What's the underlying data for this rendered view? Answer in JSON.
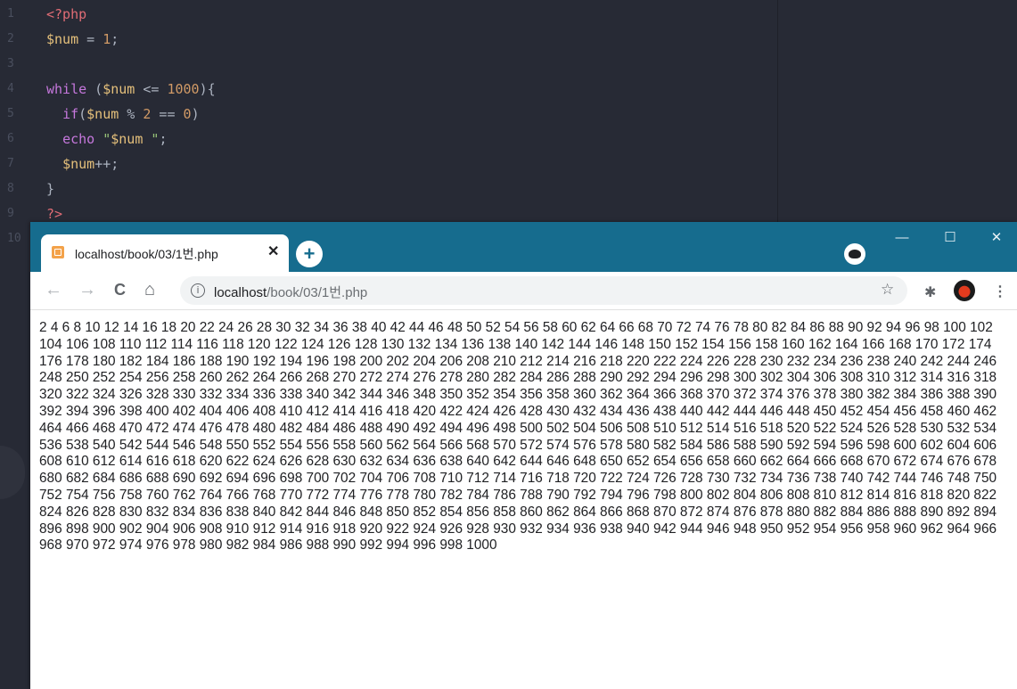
{
  "editor": {
    "line_numbers": [
      "1",
      "2",
      "3",
      "4",
      "5",
      "6",
      "7",
      "8",
      "9",
      "10"
    ],
    "lines": [
      [
        {
          "c": "t",
          "v": "<?php"
        }
      ],
      [
        {
          "c": "v",
          "v": "$num"
        },
        {
          "c": "p",
          "v": " = "
        },
        {
          "c": "n",
          "v": "1"
        },
        {
          "c": "p",
          "v": ";"
        }
      ],
      [],
      [
        {
          "c": "k",
          "v": "while"
        },
        {
          "c": "p",
          "v": " ("
        },
        {
          "c": "v",
          "v": "$num"
        },
        {
          "c": "p",
          "v": " <= "
        },
        {
          "c": "n",
          "v": "1000"
        },
        {
          "c": "p",
          "v": "){"
        }
      ],
      [
        {
          "c": "p",
          "v": "  "
        },
        {
          "c": "k",
          "v": "if"
        },
        {
          "c": "p",
          "v": "("
        },
        {
          "c": "v",
          "v": "$num"
        },
        {
          "c": "p",
          "v": " % "
        },
        {
          "c": "n",
          "v": "2"
        },
        {
          "c": "p",
          "v": " == "
        },
        {
          "c": "n",
          "v": "0"
        },
        {
          "c": "p",
          "v": ")"
        }
      ],
      [
        {
          "c": "p",
          "v": "  "
        },
        {
          "c": "k",
          "v": "echo"
        },
        {
          "c": "p",
          "v": " "
        },
        {
          "c": "s",
          "v": "\""
        },
        {
          "c": "v",
          "v": "$num"
        },
        {
          "c": "s",
          "v": " \""
        },
        {
          "c": "p",
          "v": ";"
        }
      ],
      [
        {
          "c": "p",
          "v": "  "
        },
        {
          "c": "v",
          "v": "$num"
        },
        {
          "c": "p",
          "v": "++;"
        }
      ],
      [
        {
          "c": "p",
          "v": "}"
        }
      ],
      [
        {
          "c": "t",
          "v": "?>"
        }
      ],
      []
    ]
  },
  "browser": {
    "tab_title": "localhost/book/03/1번.php",
    "tab_close": "✕",
    "new_tab": "+",
    "window_minimize": "—",
    "window_maximize": "☐",
    "window_close": "✕",
    "nav_back": "←",
    "nav_forward": "→",
    "nav_reload": "C",
    "nav_home": "⌂",
    "info_icon": "i",
    "url_host": "localhost",
    "url_path": "/book/03/1번.php",
    "star": "☆",
    "extensions": "✱",
    "menu": "⋮",
    "output": "2 4 6 8 10 12 14 16 18 20 22 24 26 28 30 32 34 36 38 40 42 44 46 48 50 52 54 56 58 60 62 64 66 68 70 72 74 76 78 80 82 84 86 88 90 92 94 96 98 100 102 104 106 108 110 112 114 116 118 120 122 124 126 128 130 132 134 136 138 140 142 144 146 148 150 152 154 156 158 160 162 164 166 168 170 172 174 176 178 180 182 184 186 188 190 192 194 196 198 200 202 204 206 208 210 212 214 216 218 220 222 224 226 228 230 232 234 236 238 240 242 244 246 248 250 252 254 256 258 260 262 264 266 268 270 272 274 276 278 280 282 284 286 288 290 292 294 296 298 300 302 304 306 308 310 312 314 316 318 320 322 324 326 328 330 332 334 336 338 340 342 344 346 348 350 352 354 356 358 360 362 364 366 368 370 372 374 376 378 380 382 384 386 388 390 392 394 396 398 400 402 404 406 408 410 412 414 416 418 420 422 424 426 428 430 432 434 436 438 440 442 444 446 448 450 452 454 456 458 460 462 464 466 468 470 472 474 476 478 480 482 484 486 488 490 492 494 496 498 500 502 504 506 508 510 512 514 516 518 520 522 524 526 528 530 532 534 536 538 540 542 544 546 548 550 552 554 556 558 560 562 564 566 568 570 572 574 576 578 580 582 584 586 588 590 592 594 596 598 600 602 604 606 608 610 612 614 616 618 620 622 624 626 628 630 632 634 636 638 640 642 644 646 648 650 652 654 656 658 660 662 664 666 668 670 672 674 676 678 680 682 684 686 688 690 692 694 696 698 700 702 704 706 708 710 712 714 716 718 720 722 724 726 728 730 732 734 736 738 740 742 744 746 748 750 752 754 756 758 760 762 764 766 768 770 772 774 776 778 780 782 784 786 788 790 792 794 796 798 800 802 804 806 808 810 812 814 816 818 820 822 824 826 828 830 832 834 836 838 840 842 844 846 848 850 852 854 856 858 860 862 864 866 868 870 872 874 876 878 880 882 884 886 888 890 892 894 896 898 900 902 904 906 908 910 912 914 916 918 920 922 924 926 928 930 932 934 936 938 940 942 944 946 948 950 952 954 956 958 960 962 964 966 968 970 972 974 976 978 980 982 984 986 988 990 992 994 996 998 1000"
  }
}
